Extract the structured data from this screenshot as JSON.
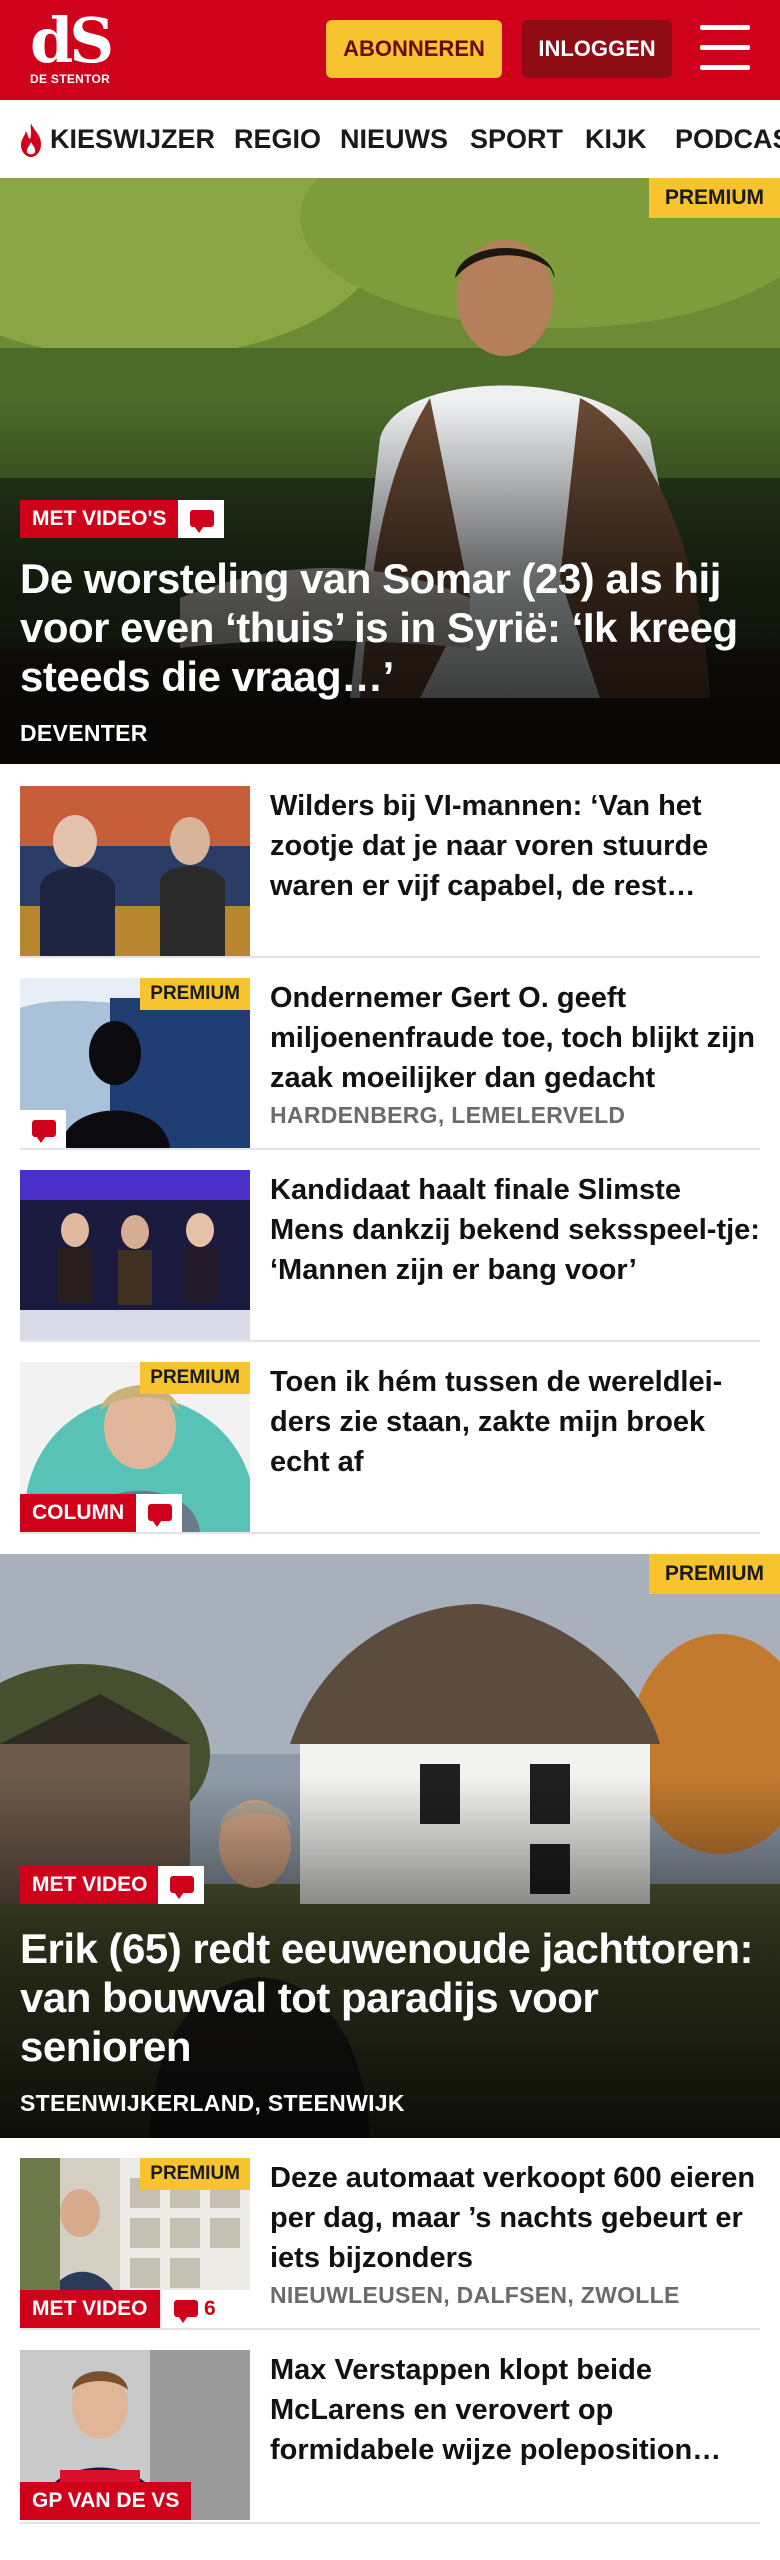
{
  "header": {
    "logo_mark": "dS",
    "logo_sub": "DE STENTOR",
    "subscribe_label": "ABONNEREN",
    "login_label": "INLOGGEN",
    "menu_icon": "hamburger-menu-icon",
    "brand_color": "#d0021b",
    "accent_color": "#f7c32e"
  },
  "nav": {
    "items": [
      {
        "label": "KIESWIJZER",
        "icon": "flame-icon"
      },
      {
        "label": "REGIO"
      },
      {
        "label": "NIEUWS"
      },
      {
        "label": "SPORT"
      },
      {
        "label": "KIJK"
      },
      {
        "label": "PODCAS"
      }
    ]
  },
  "hero1": {
    "badge": "PREMIUM",
    "tag": "MET VIDEO'S",
    "comment_icon": "comment-icon",
    "title": "De worsteling van Somar (23) als hij voor even ‘thuis’ is in Syrië: ‘Ik kreeg steeds die vraag…’",
    "location": "DEVENTER"
  },
  "articles1": [
    {
      "title": "Wilders bij VI-mannen: ‘Van het zootje dat je naar voren stuurde waren er vijf capabel, de rest…"
    },
    {
      "badge": "PREMIUM",
      "title": "Ondernemer Gert O. geeft miljoenenfraude toe, toch blijkt zijn zaak moeilijker dan gedacht",
      "location": "HARDENBERG, LEMELERVELD"
    },
    {
      "title": "Kandidaat haalt finale Slimste Mens dankzij bekend seksspeel-tje: ‘Mannen zijn er bang voor’"
    },
    {
      "badge": "PREMIUM",
      "tag": "COLUMN",
      "title": "Toen ik hém tussen de wereldlei-ders zie staan, zakte mijn broek echt af"
    }
  ],
  "hero2": {
    "badge": "PREMIUM",
    "tag": "MET VIDEO",
    "title": "Erik (65) redt eeuwenoude jachttoren: van bouwval tot paradijs voor senioren",
    "location": "STEENWIJKERLAND, STEENWIJK"
  },
  "articles2": [
    {
      "badge": "PREMIUM",
      "tag": "MET VIDEO",
      "comment_count": "6",
      "title": "Deze automaat verkoopt 600 eieren per dag, maar ’s nachts gebeurt er iets bijzonders",
      "location": "NIEUWLEUSEN, DALFSEN, ZWOLLE"
    },
    {
      "tag": "GP VAN DE VS",
      "title": "Max Verstappen klopt beide McLarens en verovert op formidabele wijze poleposition…"
    }
  ]
}
